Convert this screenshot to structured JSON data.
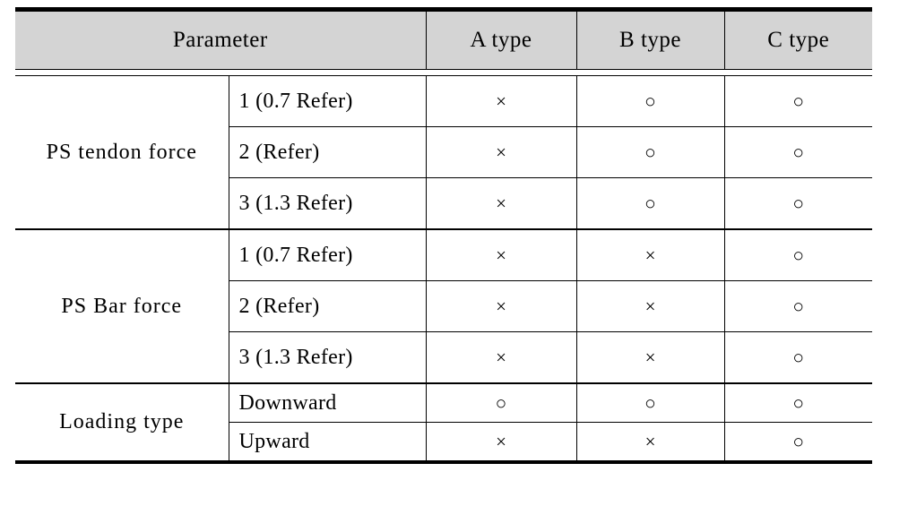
{
  "table": {
    "header": {
      "parameter_label": "Parameter",
      "type_columns": [
        "A type",
        "B type",
        "C type"
      ]
    },
    "marks": {
      "yes": "○",
      "no": "×"
    },
    "colors": {
      "header_background": "#d4d4d4",
      "rule": "#000000",
      "text": "#000000",
      "page_background": "#ffffff"
    },
    "groups": [
      {
        "label": "PS tendon force",
        "rows": [
          {
            "sub_label": "1 (0.7 Refer)",
            "a": "×",
            "b": "○",
            "c": "○"
          },
          {
            "sub_label": "2 (Refer)",
            "a": "×",
            "b": "○",
            "c": "○"
          },
          {
            "sub_label": "3 (1.3 Refer)",
            "a": "×",
            "b": "○",
            "c": "○"
          }
        ]
      },
      {
        "label": "PS Bar force",
        "rows": [
          {
            "sub_label": "1 (0.7 Refer)",
            "a": "×",
            "b": "×",
            "c": "○"
          },
          {
            "sub_label": "2 (Refer)",
            "a": "×",
            "b": "×",
            "c": "○"
          },
          {
            "sub_label": "3 (1.3 Refer)",
            "a": "×",
            "b": "×",
            "c": "○"
          }
        ]
      },
      {
        "label": "Loading type",
        "rows": [
          {
            "sub_label": "Downward",
            "a": "○",
            "b": "○",
            "c": "○"
          },
          {
            "sub_label": "Upward",
            "a": "×",
            "b": "×",
            "c": "○"
          }
        ]
      }
    ]
  }
}
